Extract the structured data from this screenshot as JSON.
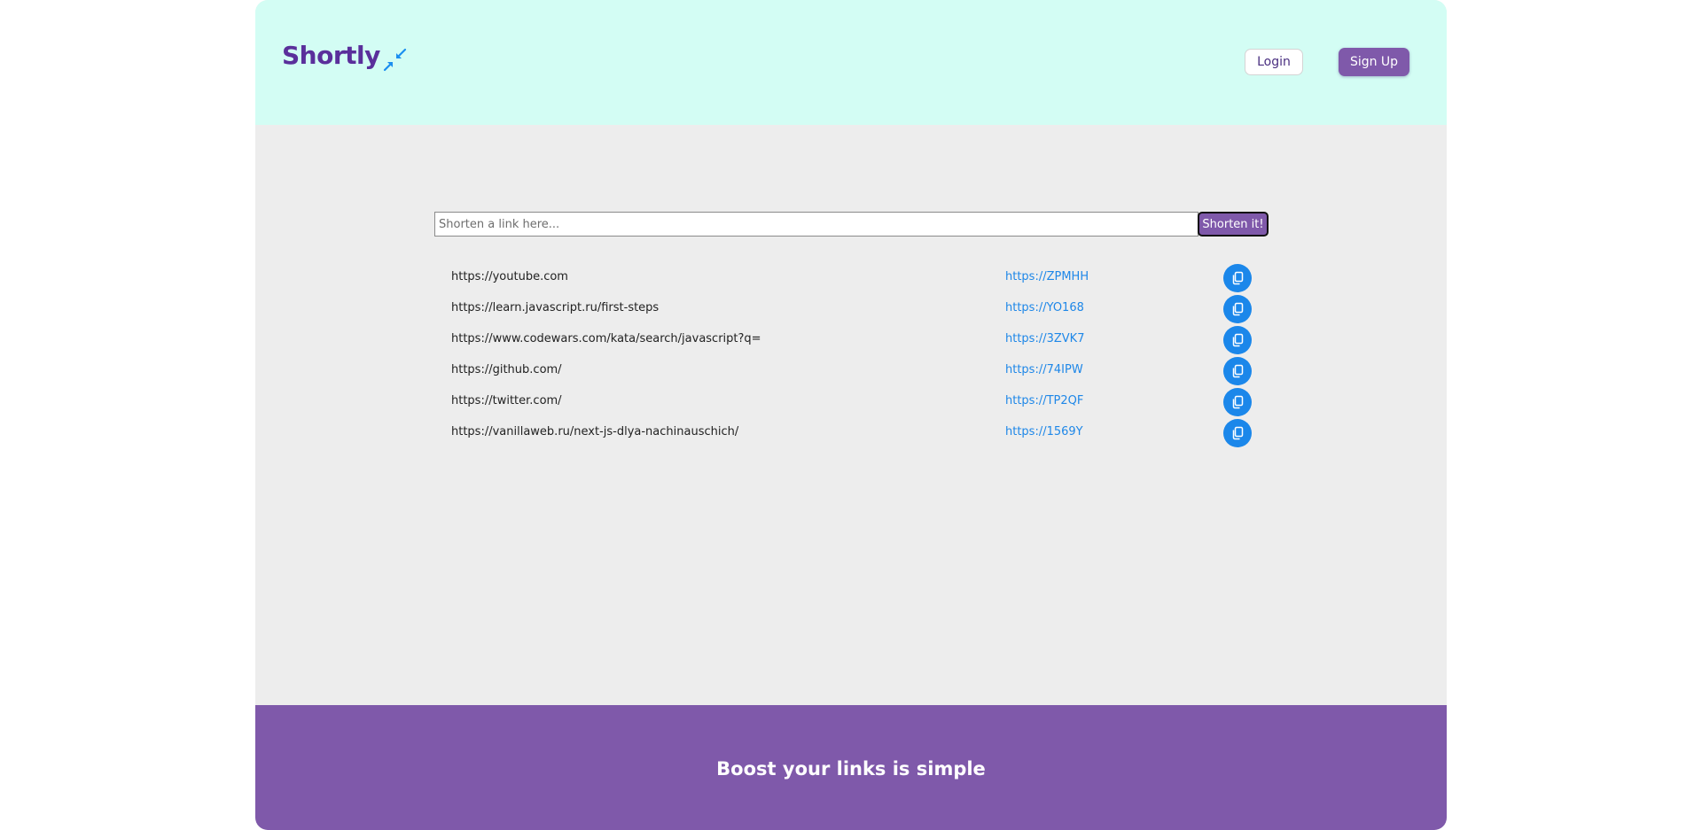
{
  "header": {
    "logo_text": "Shortly",
    "login_label": "Login",
    "signup_label": "Sign Up"
  },
  "search": {
    "placeholder": "Shorten a link here...",
    "value": "",
    "button_label": "Shorten it!"
  },
  "links": [
    {
      "original": "https://youtube.com",
      "short": "https://ZPMHH"
    },
    {
      "original": "https://learn.javascript.ru/first-steps",
      "short": "https://YO168"
    },
    {
      "original": "https://www.codewars.com/kata/search/javascript?q=",
      "short": "https://3ZVK7"
    },
    {
      "original": "https://github.com/",
      "short": "https://74IPW"
    },
    {
      "original": "https://twitter.com/",
      "short": "https://TP2QF"
    },
    {
      "original": "https://vanillaweb.ru/next-js-dlya-nachinauschich/",
      "short": "https://1569Y"
    }
  ],
  "footer": {
    "tagline": "Boost your links is simple"
  },
  "colors": {
    "header_bg": "#d3fdf4",
    "body_bg": "#ededed",
    "accent_purple": "#7f59aa",
    "logo_purple": "#5a2f9b",
    "link_blue": "#1e87e8",
    "copy_button_blue": "#1b87ea"
  },
  "icons": {
    "logo": "compress-arrows-icon",
    "copy": "copy-icon"
  }
}
